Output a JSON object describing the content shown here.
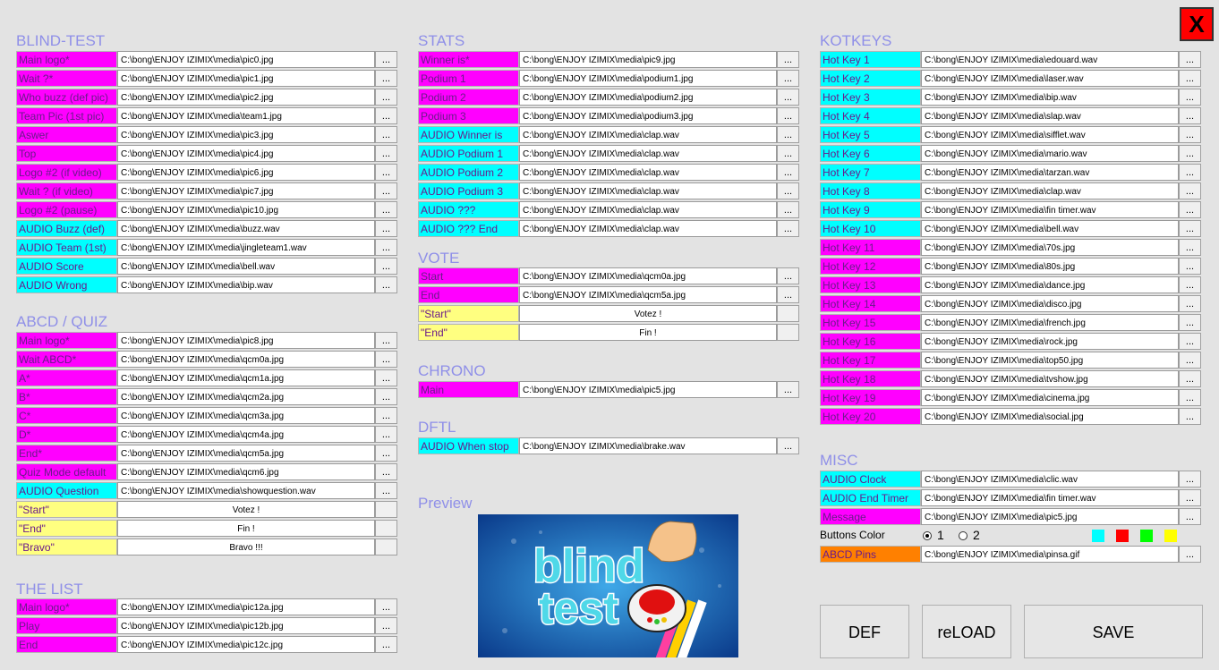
{
  "close_label": "X",
  "blind_test": {
    "title": "BLIND-TEST",
    "rows": [
      {
        "label": "Main logo*",
        "value": "C:\\bong\\ENJOY IZIMIX\\media\\pic0.jpg",
        "btn": "...",
        "color": "magenta"
      },
      {
        "label": "Wait ?*",
        "value": "C:\\bong\\ENJOY IZIMIX\\media\\pic1.jpg",
        "btn": "...",
        "color": "magenta"
      },
      {
        "label": "Who buzz (def pic)",
        "value": "C:\\bong\\ENJOY IZIMIX\\media\\pic2.jpg",
        "btn": "...",
        "color": "magenta"
      },
      {
        "label": "Team Pic (1st pic)",
        "value": "C:\\bong\\ENJOY IZIMIX\\media\\team1.jpg",
        "btn": "...",
        "color": "magenta"
      },
      {
        "label": "Aswer",
        "value": "C:\\bong\\ENJOY IZIMIX\\media\\pic3.jpg",
        "btn": "...",
        "color": "magenta"
      },
      {
        "label": "Top",
        "value": "C:\\bong\\ENJOY IZIMIX\\media\\pic4.jpg",
        "btn": "...",
        "color": "magenta"
      },
      {
        "label": "Logo #2 (if video)",
        "value": "C:\\bong\\ENJOY IZIMIX\\media\\pic6.jpg",
        "btn": "...",
        "color": "magenta"
      },
      {
        "label": "Wait ? (if video)",
        "value": "C:\\bong\\ENJOY IZIMIX\\media\\pic7.jpg",
        "btn": "...",
        "color": "magenta"
      },
      {
        "label": "Logo #2 (pause)",
        "value": "C:\\bong\\ENJOY IZIMIX\\media\\pic10.jpg",
        "btn": "...",
        "color": "magenta"
      },
      {
        "label": "AUDIO Buzz (def)",
        "value": "C:\\bong\\ENJOY IZIMIX\\media\\buzz.wav",
        "btn": "...",
        "color": "cyan"
      },
      {
        "label": "AUDIO Team (1st)",
        "value": "C:\\bong\\ENJOY IZIMIX\\media\\jingleteam1.wav",
        "btn": "...",
        "color": "cyan"
      },
      {
        "label": "AUDIO Score",
        "value": "C:\\bong\\ENJOY IZIMIX\\media\\bell.wav",
        "btn": "...",
        "color": "cyan"
      },
      {
        "label": "AUDIO Wrong",
        "value": "C:\\bong\\ENJOY IZIMIX\\media\\bip.wav",
        "btn": "...",
        "color": "cyan"
      }
    ]
  },
  "abcd_quiz": {
    "title": "ABCD / QUIZ",
    "rows": [
      {
        "label": "Main logo*",
        "value": "C:\\bong\\ENJOY IZIMIX\\media\\pic8.jpg",
        "btn": "...",
        "color": "magenta"
      },
      {
        "label": "Wait ABCD*",
        "value": "C:\\bong\\ENJOY IZIMIX\\media\\qcm0a.jpg",
        "btn": "...",
        "color": "magenta"
      },
      {
        "label": "A*",
        "value": "C:\\bong\\ENJOY IZIMIX\\media\\qcm1a.jpg",
        "btn": "...",
        "color": "magenta"
      },
      {
        "label": "B*",
        "value": "C:\\bong\\ENJOY IZIMIX\\media\\qcm2a.jpg",
        "btn": "...",
        "color": "magenta"
      },
      {
        "label": "C*",
        "value": "C:\\bong\\ENJOY IZIMIX\\media\\qcm3a.jpg",
        "btn": "...",
        "color": "magenta"
      },
      {
        "label": "D*",
        "value": "C:\\bong\\ENJOY IZIMIX\\media\\qcm4a.jpg",
        "btn": "...",
        "color": "magenta"
      },
      {
        "label": "End*",
        "value": "C:\\bong\\ENJOY IZIMIX\\media\\qcm5a.jpg",
        "btn": "...",
        "color": "magenta"
      },
      {
        "label": "Quiz Mode default",
        "value": "C:\\bong\\ENJOY IZIMIX\\media\\qcm6.jpg",
        "btn": "...",
        "color": "magenta"
      },
      {
        "label": "AUDIO Question",
        "value": "C:\\bong\\ENJOY IZIMIX\\media\\showquestion.wav",
        "btn": "...",
        "color": "cyan"
      },
      {
        "label": "\"Start\"",
        "value": "Votez !",
        "btn": "",
        "color": "yellow"
      },
      {
        "label": "\"End\"",
        "value": "Fin !",
        "btn": "",
        "color": "yellow"
      },
      {
        "label": "\"Bravo\"",
        "value": "Bravo !!!",
        "btn": "",
        "color": "yellow"
      }
    ]
  },
  "the_list": {
    "title": "THE LIST",
    "rows": [
      {
        "label": "Main logo*",
        "value": "C:\\bong\\ENJOY IZIMIX\\media\\pic12a.jpg",
        "btn": "...",
        "color": "magenta"
      },
      {
        "label": "Play",
        "value": "C:\\bong\\ENJOY IZIMIX\\media\\pic12b.jpg",
        "btn": "...",
        "color": "magenta"
      },
      {
        "label": "End",
        "value": "C:\\bong\\ENJOY IZIMIX\\media\\pic12c.jpg",
        "btn": "...",
        "color": "magenta"
      }
    ]
  },
  "stats": {
    "title": "STATS",
    "rows": [
      {
        "label": "Winner is*",
        "value": "C:\\bong\\ENJOY IZIMIX\\media\\pic9.jpg",
        "btn": "...",
        "color": "magenta"
      },
      {
        "label": "Podium 1",
        "value": "C:\\bong\\ENJOY IZIMIX\\media\\podium1.jpg",
        "btn": "...",
        "color": "magenta"
      },
      {
        "label": "Podium 2",
        "value": "C:\\bong\\ENJOY IZIMIX\\media\\podium2.jpg",
        "btn": "...",
        "color": "magenta"
      },
      {
        "label": "Podium 3",
        "value": "C:\\bong\\ENJOY IZIMIX\\media\\podium3.jpg",
        "btn": "...",
        "color": "magenta"
      },
      {
        "label": "AUDIO Winner is",
        "value": "C:\\bong\\ENJOY IZIMIX\\media\\clap.wav",
        "btn": "...",
        "color": "cyan"
      },
      {
        "label": "AUDIO Podium 1",
        "value": "C:\\bong\\ENJOY IZIMIX\\media\\clap.wav",
        "btn": "...",
        "color": "cyan"
      },
      {
        "label": "AUDIO Podium 2",
        "value": "C:\\bong\\ENJOY IZIMIX\\media\\clap.wav",
        "btn": "...",
        "color": "cyan"
      },
      {
        "label": "AUDIO Podium 3",
        "value": "C:\\bong\\ENJOY IZIMIX\\media\\clap.wav",
        "btn": "...",
        "color": "cyan"
      },
      {
        "label": "AUDIO ???",
        "value": "C:\\bong\\ENJOY IZIMIX\\media\\clap.wav",
        "btn": "...",
        "color": "cyan"
      },
      {
        "label": "AUDIO ??? End",
        "value": "C:\\bong\\ENJOY IZIMIX\\media\\clap.wav",
        "btn": "...",
        "color": "cyan"
      }
    ]
  },
  "vote": {
    "title": "VOTE",
    "rows": [
      {
        "label": "Start",
        "value": "C:\\bong\\ENJOY IZIMIX\\media\\qcm0a.jpg",
        "btn": "...",
        "color": "magenta"
      },
      {
        "label": "End",
        "value": "C:\\bong\\ENJOY IZIMIX\\media\\qcm5a.jpg",
        "btn": "...",
        "color": "magenta"
      },
      {
        "label": "\"Start\"",
        "value": "Votez !",
        "btn": "",
        "color": "yellow"
      },
      {
        "label": "\"End\"",
        "value": "Fin !",
        "btn": "",
        "color": "yellow"
      }
    ]
  },
  "chrono": {
    "title": "CHRONO",
    "rows": [
      {
        "label": "Main",
        "value": "C:\\bong\\ENJOY IZIMIX\\media\\pic5.jpg",
        "btn": "...",
        "color": "magenta"
      }
    ]
  },
  "dftl": {
    "title": "DFTL",
    "rows": [
      {
        "label": "AUDIO When stop",
        "value": "C:\\bong\\ENJOY IZIMIX\\media\\brake.wav",
        "btn": "...",
        "color": "cyan"
      }
    ]
  },
  "preview": {
    "title": "Preview",
    "image_text_1": "blind",
    "image_text_2": "test"
  },
  "hotkeys": {
    "title": "KOTKEYS",
    "rows": [
      {
        "label": "Hot Key 1",
        "value": "C:\\bong\\ENJOY IZIMIX\\media\\edouard.wav",
        "btn": "...",
        "color": "cyan"
      },
      {
        "label": "Hot Key 2",
        "value": "C:\\bong\\ENJOY IZIMIX\\media\\laser.wav",
        "btn": "...",
        "color": "cyan"
      },
      {
        "label": "Hot Key 3",
        "value": "C:\\bong\\ENJOY IZIMIX\\media\\bip.wav",
        "btn": "...",
        "color": "cyan"
      },
      {
        "label": "Hot Key 4",
        "value": "C:\\bong\\ENJOY IZIMIX\\media\\slap.wav",
        "btn": "...",
        "color": "cyan"
      },
      {
        "label": "Hot Key 5",
        "value": "C:\\bong\\ENJOY IZIMIX\\media\\sifflet.wav",
        "btn": "...",
        "color": "cyan"
      },
      {
        "label": "Hot Key 6",
        "value": "C:\\bong\\ENJOY IZIMIX\\media\\mario.wav",
        "btn": "...",
        "color": "cyan"
      },
      {
        "label": "Hot Key 7",
        "value": "C:\\bong\\ENJOY IZIMIX\\media\\tarzan.wav",
        "btn": "...",
        "color": "cyan"
      },
      {
        "label": "Hot Key 8",
        "value": "C:\\bong\\ENJOY IZIMIX\\media\\clap.wav",
        "btn": "...",
        "color": "cyan"
      },
      {
        "label": "Hot Key 9",
        "value": "C:\\bong\\ENJOY IZIMIX\\media\\fin timer.wav",
        "btn": "...",
        "color": "cyan"
      },
      {
        "label": "Hot Key 10",
        "value": "C:\\bong\\ENJOY IZIMIX\\media\\bell.wav",
        "btn": "...",
        "color": "cyan"
      },
      {
        "label": "Hot Key 11",
        "value": "C:\\bong\\ENJOY IZIMIX\\media\\70s.jpg",
        "btn": "...",
        "color": "magenta"
      },
      {
        "label": "Hot Key 12",
        "value": "C:\\bong\\ENJOY IZIMIX\\media\\80s.jpg",
        "btn": "...",
        "color": "magenta"
      },
      {
        "label": "Hot Key 13",
        "value": "C:\\bong\\ENJOY IZIMIX\\media\\dance.jpg",
        "btn": "...",
        "color": "magenta"
      },
      {
        "label": "Hot Key 14",
        "value": "C:\\bong\\ENJOY IZIMIX\\media\\disco.jpg",
        "btn": "...",
        "color": "magenta"
      },
      {
        "label": "Hot Key 15",
        "value": "C:\\bong\\ENJOY IZIMIX\\media\\french.jpg",
        "btn": "...",
        "color": "magenta"
      },
      {
        "label": "Hot Key 16",
        "value": "C:\\bong\\ENJOY IZIMIX\\media\\rock.jpg",
        "btn": "...",
        "color": "magenta"
      },
      {
        "label": "Hot Key 17",
        "value": "C:\\bong\\ENJOY IZIMIX\\media\\top50.jpg",
        "btn": "...",
        "color": "magenta"
      },
      {
        "label": "Hot Key 18",
        "value": "C:\\bong\\ENJOY IZIMIX\\media\\tvshow.jpg",
        "btn": "...",
        "color": "magenta"
      },
      {
        "label": "Hot Key 19",
        "value": "C:\\bong\\ENJOY IZIMIX\\media\\cinema.jpg",
        "btn": "...",
        "color": "magenta"
      },
      {
        "label": "Hot Key 20",
        "value": "C:\\bong\\ENJOY IZIMIX\\media\\social.jpg",
        "btn": "...",
        "color": "magenta"
      }
    ]
  },
  "misc": {
    "title": "MISC",
    "rows": [
      {
        "label": "AUDIO Clock",
        "value": "C:\\bong\\ENJOY IZIMIX\\media\\clic.wav",
        "btn": "...",
        "color": "cyan"
      },
      {
        "label": "AUDIO End Timer",
        "value": "C:\\bong\\ENJOY IZIMIX\\media\\fin timer.wav",
        "btn": "...",
        "color": "cyan"
      },
      {
        "label": "Message",
        "value": "C:\\bong\\ENJOY IZIMIX\\media\\pic5.jpg",
        "btn": "...",
        "color": "magenta"
      }
    ],
    "buttons_color_label": "Buttons Color",
    "radio_1": "1",
    "radio_2": "2",
    "selected_radio": "1",
    "swatches": [
      "#00ffff",
      "#ff0000",
      "#00ff00",
      "#ffff00"
    ],
    "pins": {
      "label": "ABCD Pins",
      "value": "C:\\bong\\ENJOY IZIMIX\\media\\pinsa.gif",
      "btn": "...",
      "color": "orange"
    }
  },
  "footer": {
    "def_label": "DEF",
    "reload_label": "reLOAD",
    "save_label": "SAVE"
  }
}
